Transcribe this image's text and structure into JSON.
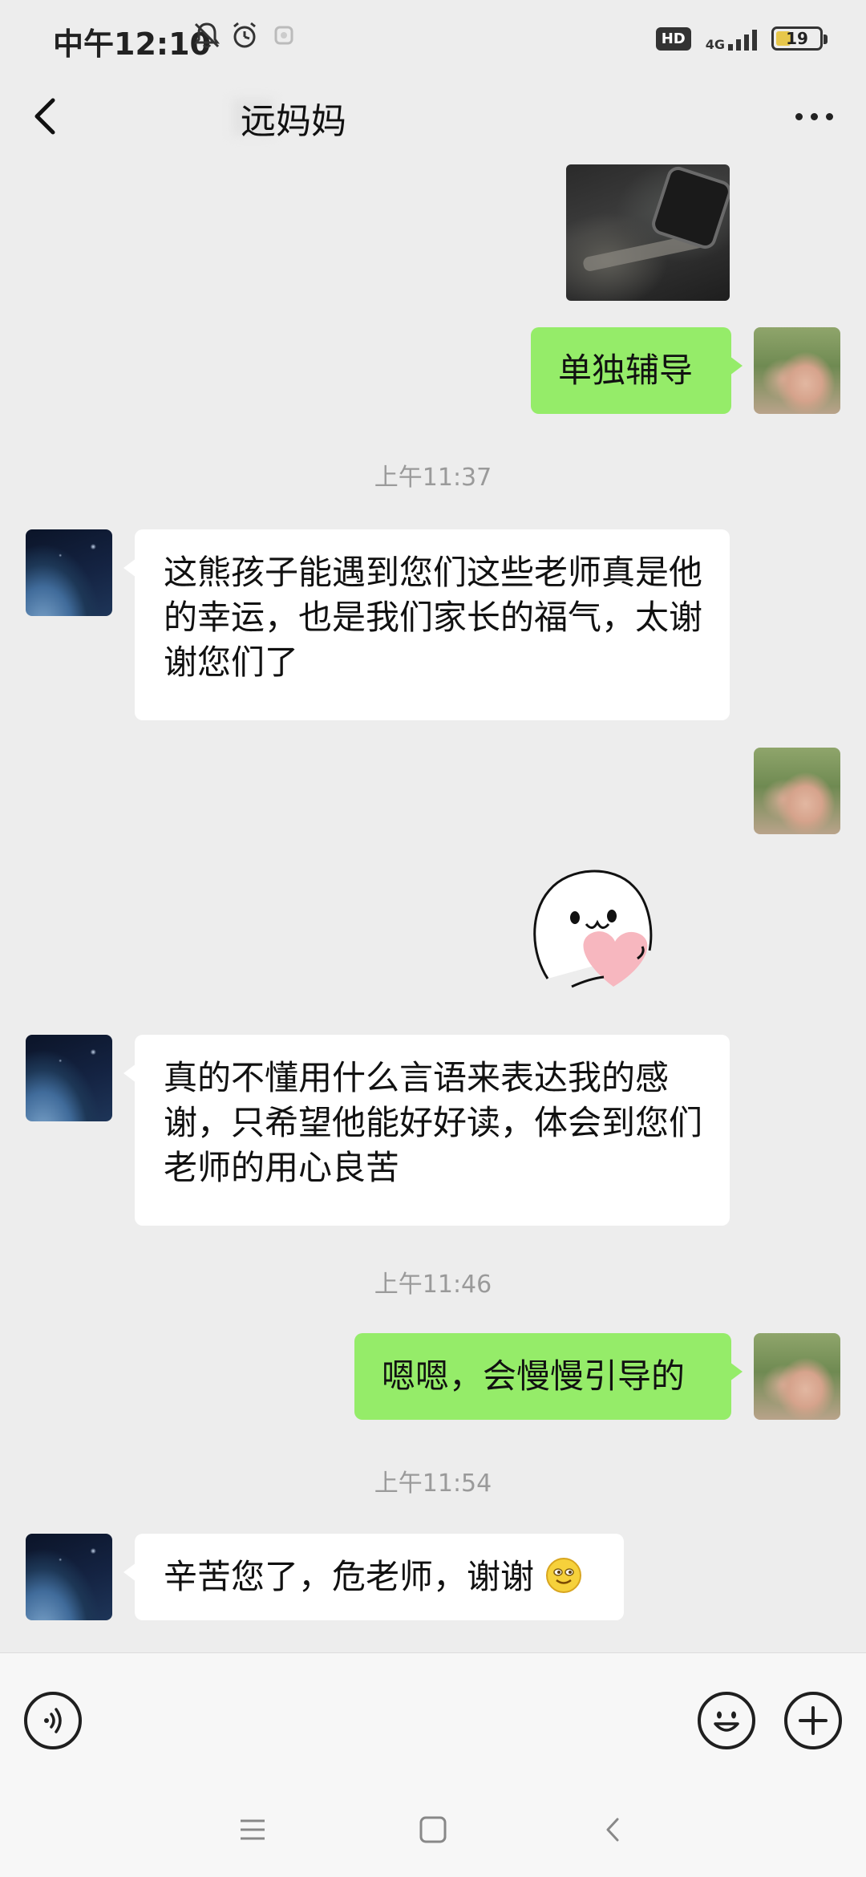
{
  "status_bar": {
    "time": "中午12:10",
    "icons": [
      "bell-off-icon",
      "alarm-icon",
      "notification-icon"
    ],
    "hd": "HD",
    "network": "4G",
    "battery": "19"
  },
  "header": {
    "title": "远妈妈",
    "back_icon": "chevron-left-icon",
    "more_icon": "more-dots-icon"
  },
  "messages": {
    "m1": "单独辅导",
    "t1": "上午11:37",
    "m2": "这熊孩子能遇到您们这些老师真是他的幸运，也是我们家长的福气，太谢谢您们了",
    "m3": "真的不懂用什么言语来表达我的感谢，只希望他能好好读，体会到您们老师的用心良苦",
    "t2": "上午11:46",
    "m4": "嗯嗯，会慢慢引导的",
    "t3": "上午11:54",
    "m5": "辛苦您了，危老师，谢谢"
  },
  "input_bar": {
    "voice_icon": "voice-icon",
    "emoji_icon": "emoji-icon",
    "plus_icon": "plus-icon"
  },
  "nav_bar": {
    "icons": [
      "menu-icon",
      "home-icon",
      "back-icon"
    ]
  },
  "colors": {
    "background": "#ededed",
    "sent_bubble": "#95ec69",
    "received_bubble": "#ffffff",
    "timestamp": "#9a9a9a"
  }
}
